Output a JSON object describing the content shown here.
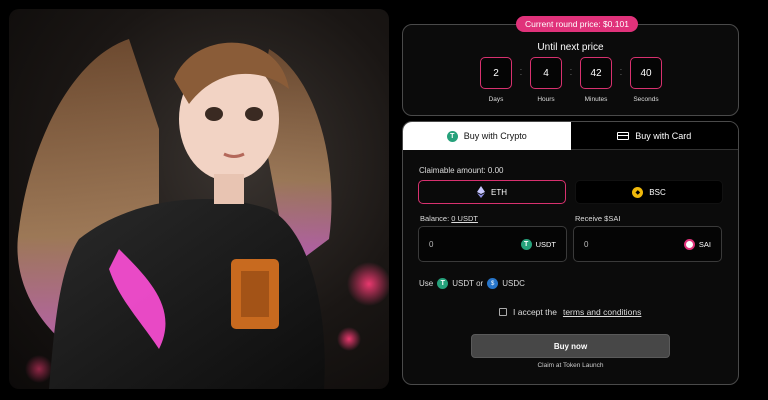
{
  "hero": {
    "image": "anime-girl-leather-jacket-illustration"
  },
  "price_pill": "Current round price: $0.101",
  "timer": {
    "title": "Until next price",
    "units": [
      {
        "value": "2",
        "label": "Days"
      },
      {
        "value": "4",
        "label": "Hours"
      },
      {
        "value": "42",
        "label": "Minutes"
      },
      {
        "value": "40",
        "label": "Seconds"
      }
    ]
  },
  "tabs": {
    "crypto": "Buy with Crypto",
    "card": "Buy with Card"
  },
  "claimable": "Claimable amount: 0.00",
  "networks": {
    "eth": "ETH",
    "bsc": "BSC"
  },
  "balance": {
    "label": "Balance:",
    "value": "0 USDT"
  },
  "receive_label": "Receive $SAI",
  "pay_field": {
    "value": "0",
    "token": "USDT"
  },
  "receive_field": {
    "value": "0",
    "token": "SAI"
  },
  "use_row": {
    "prefix": "Use",
    "token1": "USDT or",
    "token2": "USDC"
  },
  "accept": {
    "text": "I accept the",
    "link": "terms and conditions"
  },
  "buy_button": "Buy now",
  "claim_note": "Claim at Token Launch",
  "colors": {
    "accent": "#e0327a",
    "usdt": "#26a17b",
    "usdc": "#2775ca",
    "bsc": "#f0b90b"
  }
}
